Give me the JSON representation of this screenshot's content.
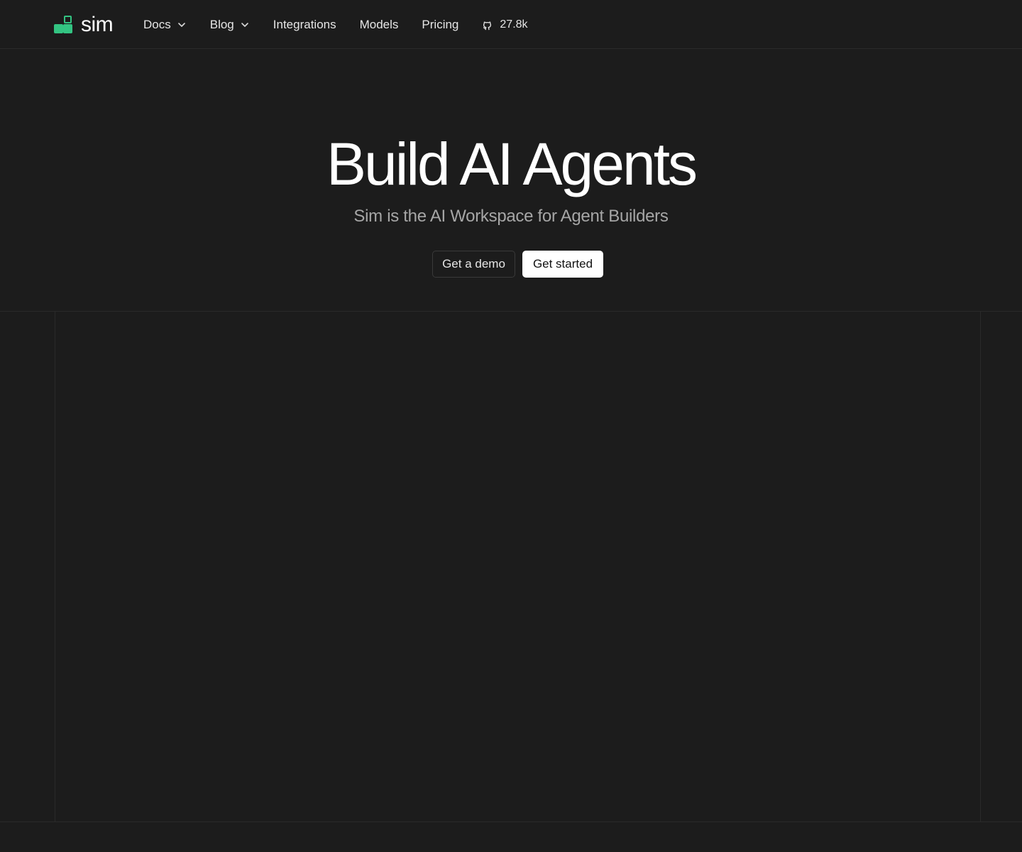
{
  "brand": {
    "name": "sim",
    "accent_color": "#33c482",
    "logo_icon": "blocks-logo-icon"
  },
  "nav": {
    "items": [
      {
        "label": "Docs",
        "has_dropdown": true
      },
      {
        "label": "Blog",
        "has_dropdown": true
      },
      {
        "label": "Integrations",
        "has_dropdown": false
      },
      {
        "label": "Models",
        "has_dropdown": false
      },
      {
        "label": "Pricing",
        "has_dropdown": false
      }
    ],
    "github": {
      "icon": "github-icon",
      "stars": "27.8k"
    }
  },
  "hero": {
    "title": "Build AI Agents",
    "subtitle": "Sim is the AI Workspace for Agent Builders",
    "demo_label": "Get a demo",
    "start_label": "Get started"
  },
  "colors": {
    "background": "#1c1c1c",
    "border": "#2a2a2a",
    "subtitle": "#a6a6a6"
  }
}
